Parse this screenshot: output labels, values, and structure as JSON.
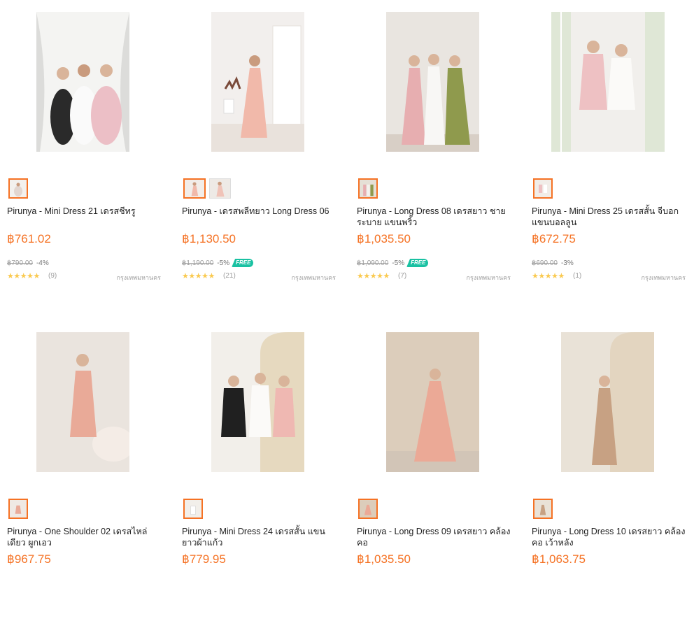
{
  "products": [
    {
      "title": "Pirunya - Mini Dress 21 เดรสชีทรู",
      "price": "฿761.02",
      "original_price": "฿790.00",
      "discount": "-4%",
      "free_shipping": false,
      "stars": "★★★★★",
      "rating_count": "(9)",
      "location": "กรุงเทพมหานคร",
      "thumbnail_count": 1
    },
    {
      "title": "Pirunya - เดรสพลีทยาว Long Dress 06",
      "price": "฿1,130.50",
      "original_price": "฿1,190.00",
      "discount": "-5%",
      "free_shipping": true,
      "free_label": "FREE",
      "stars": "★★★★★",
      "rating_count": "(21)",
      "location": "กรุงเทพมหานคร",
      "thumbnail_count": 2
    },
    {
      "title": "Pirunya - Long Dress 08 เดรสยาว ชายระบาย แขนพริ้ว",
      "price": "฿1,035.50",
      "original_price": "฿1,090.00",
      "discount": "-5%",
      "free_shipping": true,
      "free_label": "FREE",
      "stars": "★★★★★",
      "rating_count": "(7)",
      "location": "กรุงเทพมหานคร",
      "thumbnail_count": 1
    },
    {
      "title": "Pirunya - Mini Dress 25 เดรสสั้น จีบอก แขนบอลลูน",
      "price": "฿672.75",
      "original_price": "฿690.00",
      "discount": "-3%",
      "free_shipping": false,
      "stars": "★★★★★",
      "rating_count": "(1)",
      "location": "กรุงเทพมหานคร",
      "thumbnail_count": 1
    },
    {
      "title": "Pirunya - One Shoulder 02 เดรสไหล่เดียว ผูกเอว",
      "price": "฿967.75",
      "thumbnail_count": 1
    },
    {
      "title": "Pirunya - Mini Dress 24 เดรสสั้น แขนยาวผ้าแก้ว",
      "price": "฿779.95",
      "thumbnail_count": 1
    },
    {
      "title": "Pirunya - Long Dress 09 เดรสยาว คล้องคอ",
      "price": "฿1,035.50",
      "thumbnail_count": 1
    },
    {
      "title": "Pirunya - Long Dress 10 เดรสยาว คล้องคอ เว้าหลัง",
      "price": "฿1,063.75",
      "thumbnail_count": 1
    }
  ],
  "colors": {
    "accent": "#f57224",
    "free_badge": "#19c1a2",
    "star": "#faca51"
  }
}
